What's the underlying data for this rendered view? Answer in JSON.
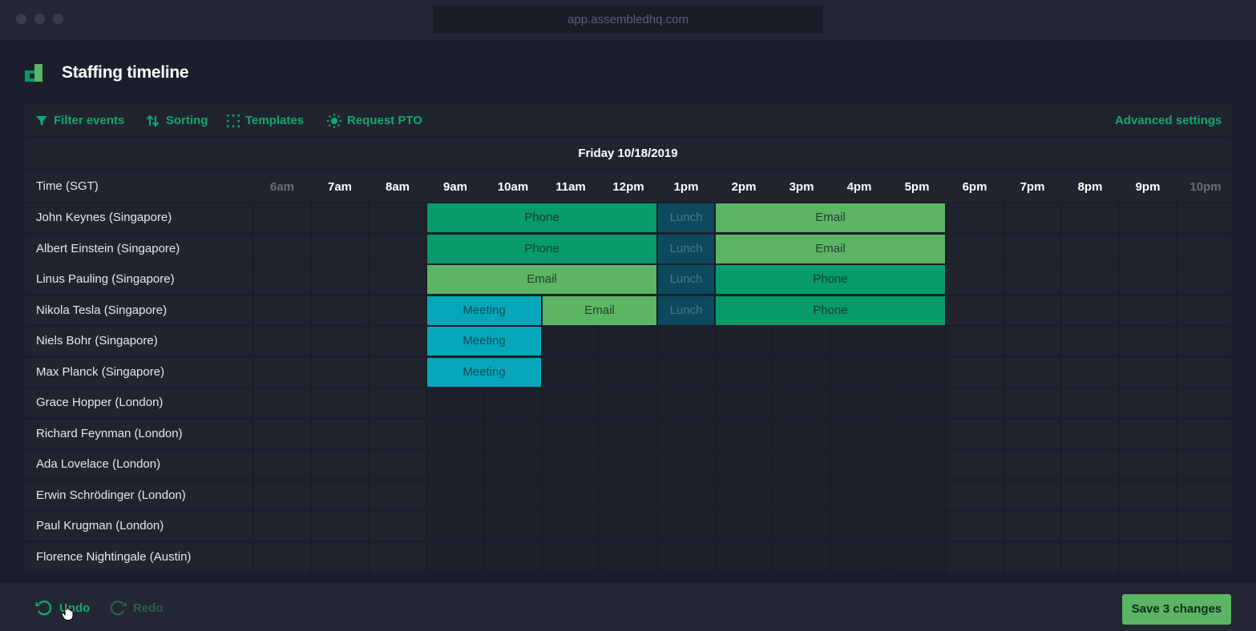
{
  "browser": {
    "url": "app.assembledhq.com"
  },
  "header": {
    "title": "Staffing timeline"
  },
  "toolbar": {
    "filter_label": "Filter events",
    "sorting_label": "Sorting",
    "templates_label": "Templates",
    "pto_label": "Request PTO",
    "advanced_label": "Advanced settings",
    "icons": [
      "filter-icon",
      "sort-icon",
      "templates-icon",
      "sun-icon"
    ]
  },
  "schedule": {
    "date": "Friday 10/18/2019",
    "time_label": "Time (SGT)",
    "hours": [
      "6am",
      "7am",
      "8am",
      "9am",
      "10am",
      "11am",
      "12pm",
      "1pm",
      "2pm",
      "3pm",
      "4pm",
      "5pm",
      "6pm",
      "7pm",
      "8pm",
      "9pm",
      "10pm"
    ],
    "agents": [
      {
        "name": "John Keynes (Singapore)"
      },
      {
        "name": "Albert Einstein (Singapore)"
      },
      {
        "name": "Linus Pauling (Singapore)"
      },
      {
        "name": "Nikola Tesla (Singapore)"
      },
      {
        "name": "Niels Bohr (Singapore)"
      },
      {
        "name": "Max Planck (Singapore)"
      },
      {
        "name": "Grace Hopper (London)"
      },
      {
        "name": "Richard Feynman (London)"
      },
      {
        "name": "Ada Lovelace (London)"
      },
      {
        "name": "Erwin Schrödinger (London)"
      },
      {
        "name": "Paul Krugman (London)"
      },
      {
        "name": "Florence Nightingale (Austin)"
      }
    ],
    "events": [
      {
        "row": 0,
        "type": "phone",
        "label": "Phone",
        "start": "9am",
        "end": "1pm"
      },
      {
        "row": 0,
        "type": "lunch",
        "label": "Lunch",
        "start": "1pm",
        "end": "2pm"
      },
      {
        "row": 0,
        "type": "email",
        "label": "Email",
        "start": "2pm",
        "end": "6pm"
      },
      {
        "row": 1,
        "type": "phone",
        "label": "Phone",
        "start": "9am",
        "end": "1pm"
      },
      {
        "row": 1,
        "type": "lunch",
        "label": "Lunch",
        "start": "1pm",
        "end": "2pm"
      },
      {
        "row": 1,
        "type": "email",
        "label": "Email",
        "start": "2pm",
        "end": "6pm"
      },
      {
        "row": 2,
        "type": "email",
        "label": "Email",
        "start": "9am",
        "end": "1pm"
      },
      {
        "row": 2,
        "type": "lunch",
        "label": "Lunch",
        "start": "1pm",
        "end": "2pm"
      },
      {
        "row": 2,
        "type": "phone",
        "label": "Phone",
        "start": "2pm",
        "end": "6pm"
      },
      {
        "row": 3,
        "type": "meeting",
        "label": "Meeting",
        "start": "9am",
        "end": "11am"
      },
      {
        "row": 3,
        "type": "email",
        "label": "Email",
        "start": "11am",
        "end": "1pm"
      },
      {
        "row": 3,
        "type": "lunch",
        "label": "Lunch",
        "start": "1pm",
        "end": "2pm"
      },
      {
        "row": 3,
        "type": "phone",
        "label": "Phone",
        "start": "2pm",
        "end": "6pm"
      },
      {
        "row": 4,
        "type": "meeting",
        "label": "Meeting",
        "start": "9am",
        "end": "11am"
      },
      {
        "row": 5,
        "type": "meeting",
        "label": "Meeting",
        "start": "9am",
        "end": "11am"
      }
    ]
  },
  "footer": {
    "undo_label": "Undo",
    "redo_label": "Redo",
    "save_label": "Save 3 changes"
  },
  "colors": {
    "accent": "#12a870",
    "phone": "#079a6a",
    "email": "#5cb565",
    "lunch": "#0b4a5d",
    "meeting": "#05a6b9",
    "background": "#1b1f2b"
  }
}
